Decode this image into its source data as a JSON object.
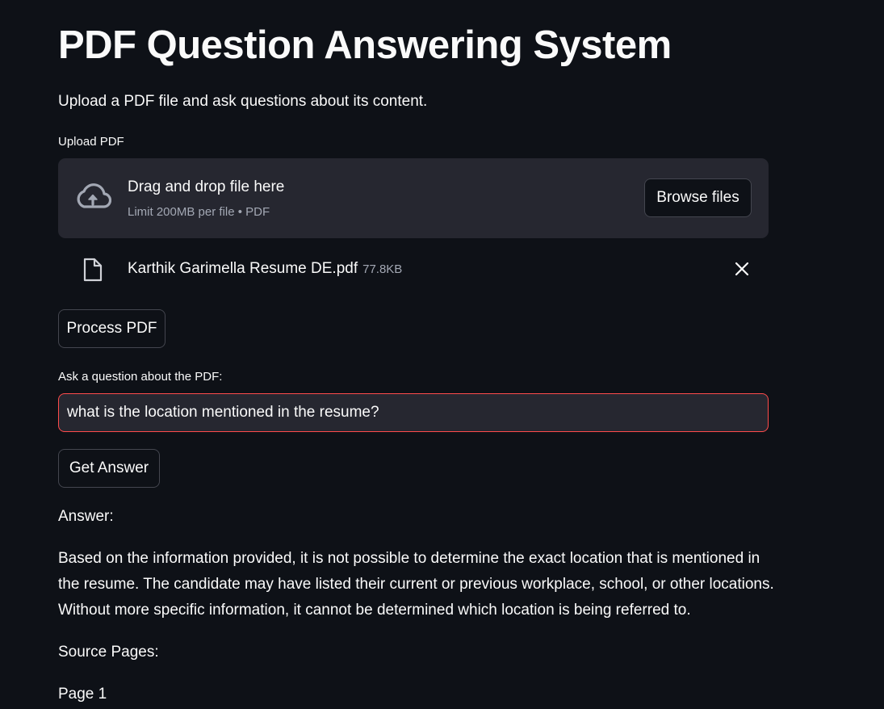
{
  "page": {
    "title": "PDF Question Answering System",
    "subtitle": "Upload a PDF file and ask questions about its content."
  },
  "uploader": {
    "label": "Upload PDF",
    "drag_text": "Drag and drop file here",
    "limit_text": "Limit 200MB per file • PDF",
    "browse_label": "Browse files",
    "icon": "cloud-upload-icon"
  },
  "uploaded_file": {
    "name": "Karthik Garimella Resume DE.pdf",
    "size": "77.8KB",
    "icon": "file-icon",
    "remove_icon": "close-icon"
  },
  "process_button": {
    "label": "Process PDF"
  },
  "question": {
    "label": "Ask a question about the PDF:",
    "value": "what is the location mentioned in the resume?"
  },
  "answer_button": {
    "label": "Get Answer"
  },
  "answer": {
    "heading": "Answer:",
    "text": "Based on the information provided, it is not possible to determine the exact location that is mentioned in the resume. The candidate may have listed their current or previous workplace, school, or other locations. Without more specific information, it cannot be determined which location is being referred to."
  },
  "sources": {
    "heading": "Source Pages:",
    "pages": [
      "Page 1"
    ]
  },
  "colors": {
    "background": "#0e1117",
    "surface": "#262730",
    "text": "#fafafa",
    "muted_text": "#a3a8b4",
    "focus_border": "#ff4b4b",
    "button_border": "#44464f"
  }
}
